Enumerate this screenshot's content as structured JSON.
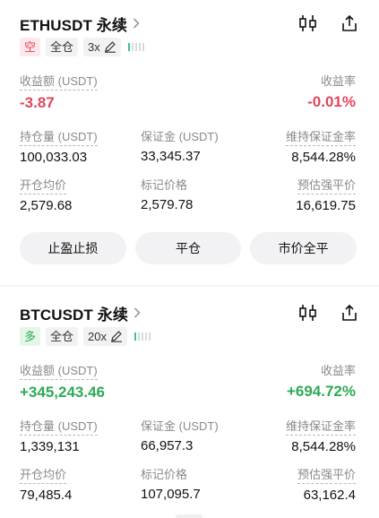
{
  "positions": [
    {
      "symbol": "ETHUSDT 永续",
      "side": "空",
      "margin_mode": "全仓",
      "leverage": "3x",
      "risk_level": 1,
      "pnl_label": "收益额 (USDT)",
      "pnl_value": "-3.87",
      "roi_label": "收益率",
      "roi_value": "-0.01%",
      "size_label": "持仓量 (USDT)",
      "size_value": "100,033.03",
      "margin_label": "保证金 (USDT)",
      "margin_value": "33,345.37",
      "mmr_label": "维持保证金率",
      "mmr_value": "8,544.28%",
      "entry_label": "开仓均价",
      "entry_value": "2,579.68",
      "mark_label": "标记价格",
      "mark_value": "2,579.78",
      "liq_label": "预估强平价",
      "liq_value": "16,619.75",
      "buttons": [
        "止盈止损",
        "平仓",
        "市价全平"
      ]
    },
    {
      "symbol": "BTCUSDT 永续",
      "side": "多",
      "margin_mode": "全仓",
      "leverage": "20x",
      "risk_level": 1,
      "pnl_label": "收益额 (USDT)",
      "pnl_value": "+345,243.46",
      "roi_label": "收益率",
      "roi_value": "+694.72%",
      "size_label": "持仓量 (USDT)",
      "size_value": "1,339,131",
      "margin_label": "保证金 (USDT)",
      "margin_value": "66,957.3",
      "mmr_label": "维持保证金率",
      "mmr_value": "8,544.28%",
      "entry_label": "开仓均价",
      "entry_value": "79,485.4",
      "mark_label": "标记价格",
      "mark_value": "107,095.7",
      "liq_label": "预估强平价",
      "liq_value": "63,162.4"
    }
  ],
  "colors": {
    "loss": "#e0465e",
    "profit": "#2eaa55",
    "risk_on": "#3cc28c"
  },
  "icons": [
    "chevron-right-icon",
    "candlestick-chart-icon",
    "share-icon",
    "edit-pencil-icon"
  ]
}
